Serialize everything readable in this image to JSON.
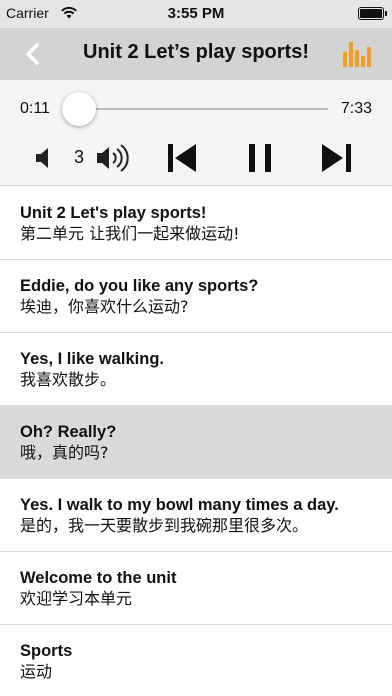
{
  "status_bar": {
    "carrier": "Carrier",
    "time": "3:55 PM"
  },
  "nav": {
    "title": "Unit 2 Let’s play sports!",
    "back_icon": "chevron-left-icon",
    "right_icon": "equalizer-icon",
    "accent_color": "#f0a020"
  },
  "player": {
    "elapsed": "0:11",
    "total": "7:33",
    "progress_fraction": 0.03,
    "volume_level": "3",
    "progress_color": "#2a82e4"
  },
  "sentences": [
    {
      "en": "Unit 2 Let's play sports!",
      "zh": "第二单元 让我们一起来做运动!",
      "active": false
    },
    {
      "en": "Eddie, do you like any sports?",
      "zh": "埃迪，你喜欢什么运动?",
      "active": false
    },
    {
      "en": "Yes, I like walking.",
      "zh": "我喜欢散步。",
      "active": false
    },
    {
      "en": "Oh? Really?",
      "zh": "哦，真的吗?",
      "active": true
    },
    {
      "en": "Yes. I walk to my bowl many times a day.",
      "zh": "是的，我一天要散步到我碗那里很多次。",
      "active": false
    },
    {
      "en": "Welcome to the unit",
      "zh": "欢迎学习本单元",
      "active": false
    },
    {
      "en": "Sports",
      "zh": "运动",
      "active": false
    }
  ]
}
